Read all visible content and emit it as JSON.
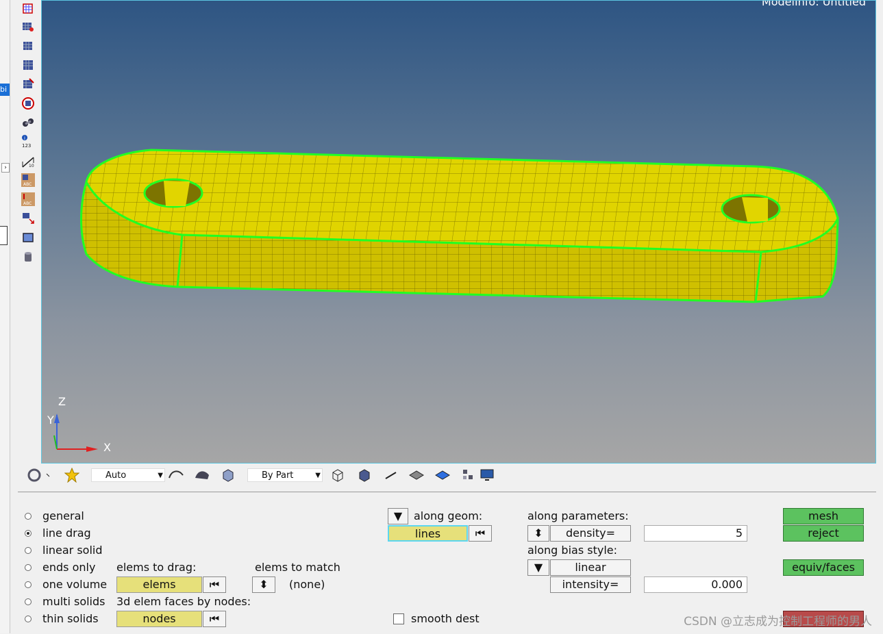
{
  "viewport": {
    "model_info": "ModelInfo: Untitled",
    "axes": {
      "x": "X",
      "y": "Y",
      "z": "Z"
    },
    "mesh_color": "#e8dc00",
    "edge_color": "#22ff22"
  },
  "toolbar": {
    "display_mode": "Auto",
    "color_mode": "By Part"
  },
  "panel": {
    "radio_options": [
      {
        "label": "general",
        "selected": false
      },
      {
        "label": "line drag",
        "selected": true
      },
      {
        "label": "linear solid",
        "selected": false
      },
      {
        "label": "ends only",
        "selected": false
      },
      {
        "label": "one volume",
        "selected": false
      },
      {
        "label": "multi solids",
        "selected": false
      },
      {
        "label": "thin solids",
        "selected": false
      }
    ],
    "elems_to_drag_label": "elems to drag:",
    "elems_button": "elems",
    "faces_by_nodes_label": "3d elem faces by nodes:",
    "nodes_button": "nodes",
    "elems_to_match_label": "elems to match",
    "match_value": "(none)",
    "along_geom_label": "along geom:",
    "lines_button": "lines",
    "smooth_dest_label": "smooth dest",
    "along_params_label": "along parameters:",
    "density_label": "density=",
    "density_value": "5",
    "bias_style_label": "along bias style:",
    "bias_style_value": "linear",
    "intensity_label": "intensity=",
    "intensity_value": "0.000",
    "mesh_button": "mesh",
    "reject_button": "reject",
    "equiv_button": "equiv/faces"
  },
  "watermark": "CSDN @立志成为控制工程师的男人"
}
